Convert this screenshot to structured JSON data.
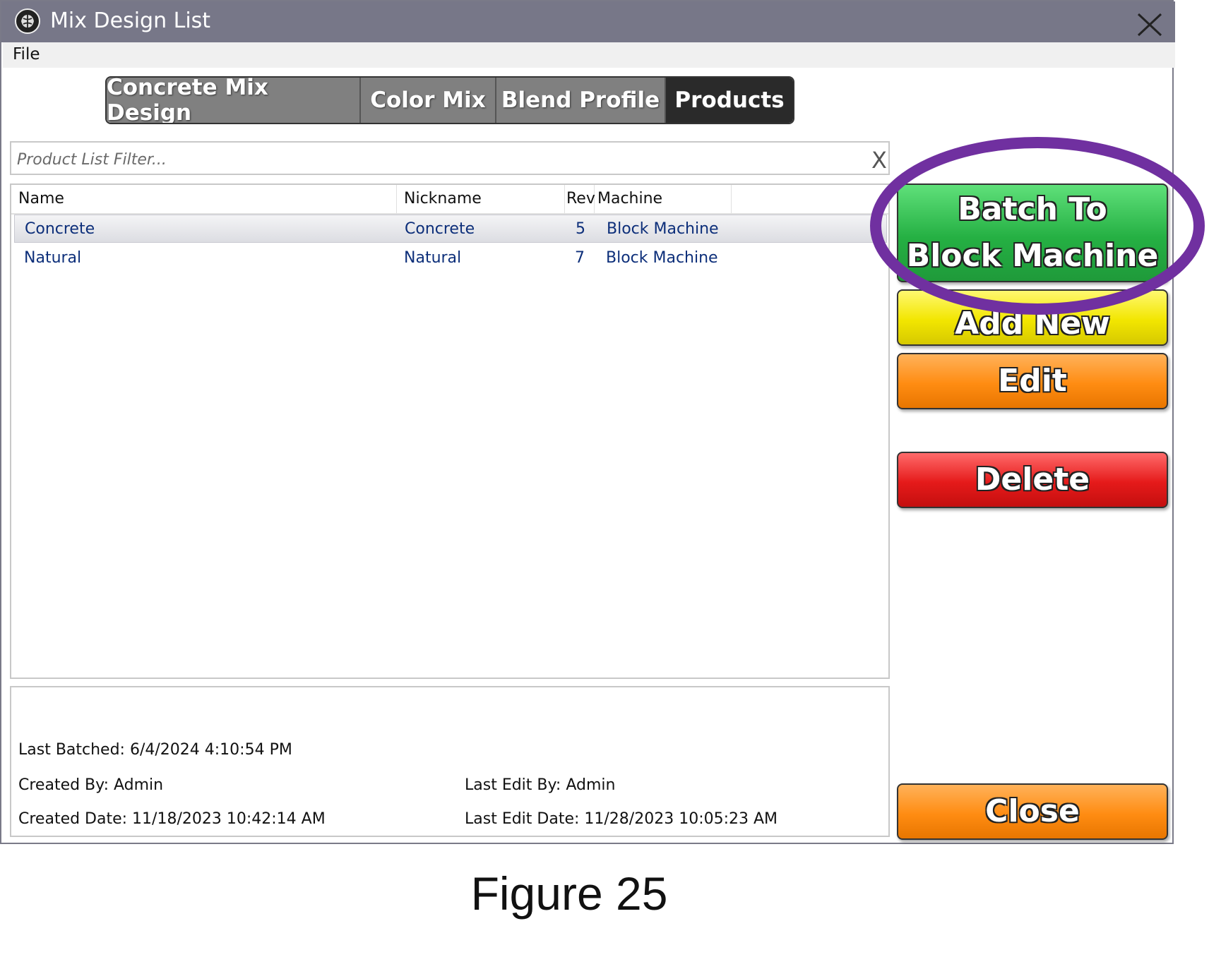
{
  "window": {
    "title": "Mix Design List",
    "app_icon": "brain-gear-icon",
    "close_icon": "close-icon"
  },
  "menu": {
    "file": "File"
  },
  "tabs": [
    {
      "label": "Concrete Mix Design",
      "active": false
    },
    {
      "label": "Color Mix",
      "active": false
    },
    {
      "label": "Blend Profile",
      "active": false
    },
    {
      "label": "Products",
      "active": true
    }
  ],
  "filter": {
    "placeholder": "Product List Filter...",
    "value": "",
    "clear_label": "X"
  },
  "table": {
    "headers": {
      "name": "Name",
      "nickname": "Nickname",
      "rev": "Rev",
      "machine": "Machine"
    },
    "rows": [
      {
        "name": "Concrete",
        "nickname": "Concrete",
        "rev": "5",
        "machine": "Block Machine",
        "selected": true
      },
      {
        "name": "Natural",
        "nickname": "Natural",
        "rev": "7",
        "machine": "Block Machine",
        "selected": false
      }
    ]
  },
  "details": {
    "last_batched": "Last Batched: 6/4/2024 4:10:54 PM",
    "created_by": "Created By: Admin",
    "last_edit_by": "Last Edit By: Admin",
    "created_date": "Created Date: 11/18/2023 10:42:14 AM",
    "last_edit_date": "Last Edit Date: 11/28/2023 10:05:23 AM"
  },
  "buttons": {
    "batch_line1": "Batch To",
    "batch_line2": "Block Machine",
    "add_new": "Add New",
    "edit": "Edit",
    "delete": "Delete",
    "close": "Close"
  },
  "annotation": {
    "ring_color": "#7030a0"
  },
  "caption": "Figure 25",
  "colors": {
    "titlebar": "#777788",
    "tab_inactive": "#808080",
    "tab_active": "#2a2a2a",
    "row_text": "#0d2f7a",
    "batch_button": "#25b043",
    "add_button": "#f2e600",
    "edit_button": "#ff8c12",
    "delete_button": "#e51a1a",
    "close_button": "#ff8c12"
  }
}
